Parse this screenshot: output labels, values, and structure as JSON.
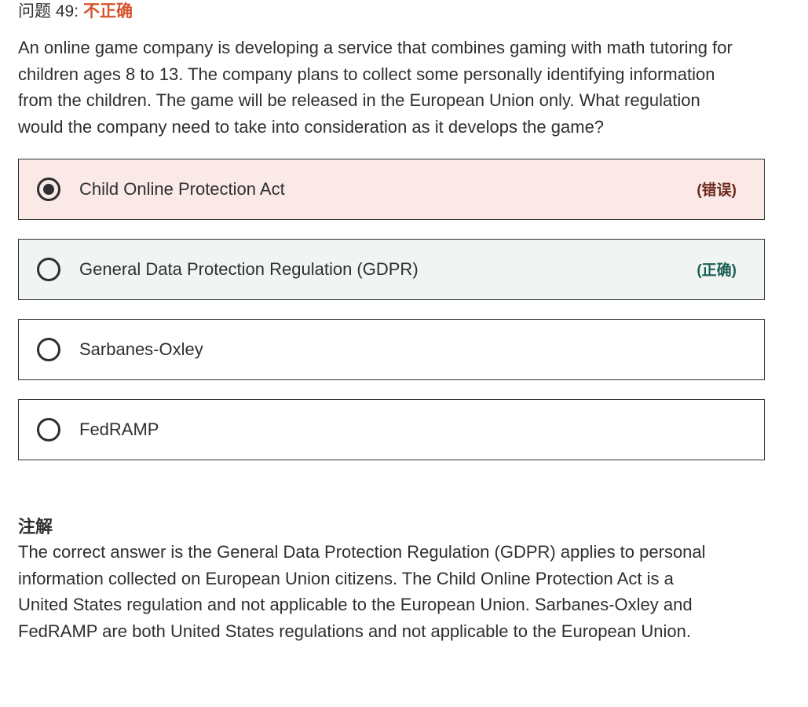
{
  "question": {
    "number_label": "问题 49:",
    "status": "不正确",
    "text": "An online game company is developing a service that combines gaming with math tutoring for children ages 8 to 13. The company plans to collect some personally identifying information from the children.  The game will be released in the European Union only. What regulation would the company need to take into consideration as it develops the game?"
  },
  "answers": [
    {
      "label": "Child Online Protection Act",
      "tag": "(错误)",
      "selected": true,
      "state": "incorrect"
    },
    {
      "label": "General Data Protection Regulation (GDPR)",
      "tag": "(正确)",
      "selected": false,
      "state": "correct"
    },
    {
      "label": "Sarbanes-Oxley",
      "tag": "",
      "selected": false,
      "state": "neutral"
    },
    {
      "label": "FedRAMP",
      "tag": "",
      "selected": false,
      "state": "neutral"
    }
  ],
  "explanation": {
    "title": "注解",
    "text": "The correct answer is the General Data Protection Regulation (GDPR) applies to personal information collected on European Union citizens. The Child Online Protection Act is a United States regulation and not applicable to the European Union.  Sarbanes-Oxley and FedRAMP are both United States regulations and not applicable to the European Union."
  },
  "colors": {
    "status_incorrect": "#d8542d",
    "incorrect_bg": "#fbe9e7",
    "correct_bg": "#f0f5f4",
    "incorrect_tag": "#6e2a1c",
    "correct_tag": "#1e6055",
    "text": "#2d2f31"
  }
}
